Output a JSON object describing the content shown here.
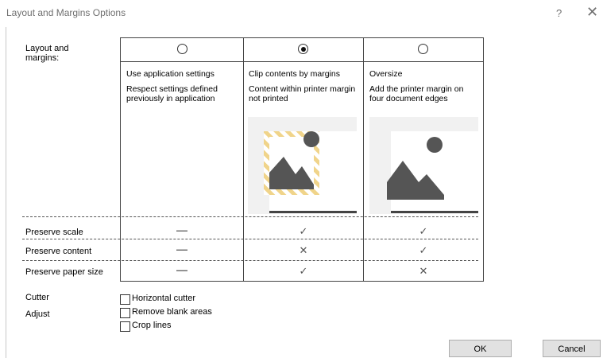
{
  "window": {
    "title": "Layout and Margins Options",
    "help_glyph": "?",
    "close_glyph": "✕"
  },
  "layout_margins": {
    "label": "Layout and\nmargins:",
    "selected": "clip",
    "options": [
      {
        "id": "app",
        "title": "Use application settings",
        "desc": "Respect settings defined\npreviously in application"
      },
      {
        "id": "clip",
        "title": "Clip contents by margins",
        "desc": "Content within printer margin\nnot printed"
      },
      {
        "id": "oversize",
        "title": "Oversize",
        "desc": "Add the printer margin on\nfour document edges"
      }
    ]
  },
  "comparison": {
    "rows": [
      {
        "label": "Preserve scale",
        "values": [
          "—",
          "✓",
          "✓"
        ]
      },
      {
        "label": "Preserve content",
        "values": [
          "—",
          "✕",
          "✓"
        ]
      },
      {
        "label": "Preserve paper size",
        "values": [
          "—",
          "✓",
          "✕"
        ]
      }
    ]
  },
  "cutter": {
    "label": "Cutter",
    "horizontal_cutter": "Horizontal cutter",
    "checked": false
  },
  "adjust": {
    "label": "Adjust",
    "remove_blank_areas": "Remove blank areas",
    "crop_lines": "Crop lines",
    "remove_blank_checked": false,
    "crop_lines_checked": false
  },
  "buttons": {
    "ok": "OK",
    "cancel": "Cancel"
  },
  "colors": {
    "stripe": "#f0d48a",
    "image": "#555555",
    "panel": "#f1f1f1"
  }
}
